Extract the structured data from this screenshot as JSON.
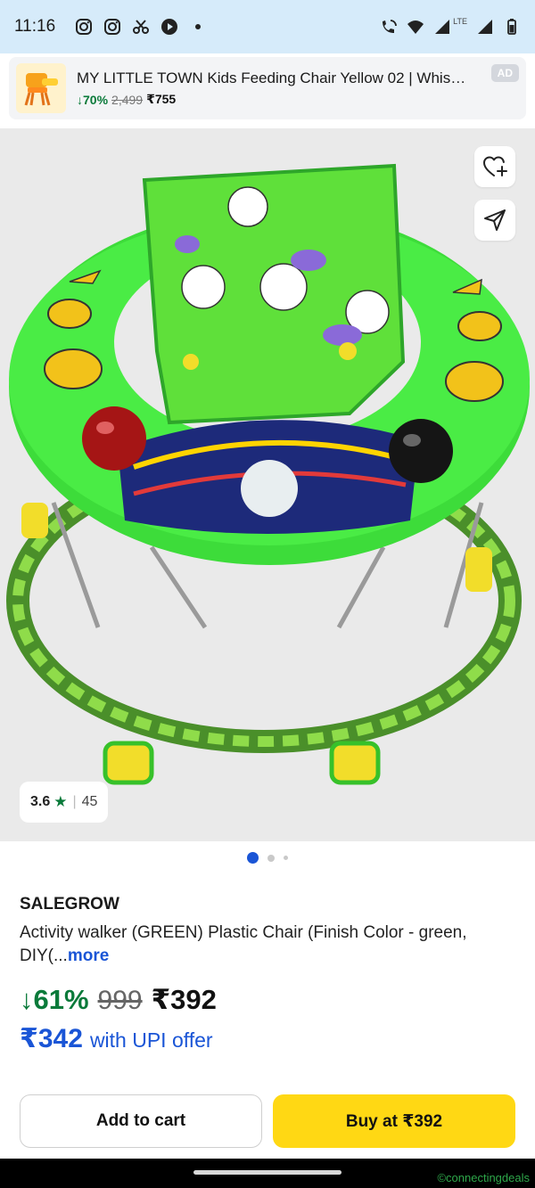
{
  "status_bar": {
    "time": "11:16",
    "left_icons": [
      "instagram-icon",
      "instagram-icon",
      "scissors-icon",
      "play-icon",
      "dot-icon"
    ],
    "network_label": "LTE",
    "right_icons": [
      "wifi-call-icon",
      "wifi-icon",
      "signal-icon",
      "signal-icon",
      "battery-icon"
    ]
  },
  "ad": {
    "title": "MY LITTLE TOWN Kids Feeding Chair Yellow 02 | Whistl...",
    "discount": "↓70%",
    "mrp": "2,499",
    "price": "₹755",
    "badge": "AD"
  },
  "product_image": {
    "rating_value": "3.6",
    "rating_star": "★",
    "rating_separator": "|",
    "rating_count": "45",
    "carousel_total": 3,
    "carousel_active": 1
  },
  "product": {
    "brand": "SALEGROW",
    "title": "Activity walker (GREEN) Plastic Chair (Finish Color - green, DIY(...",
    "more_label": "more",
    "discount": "↓61%",
    "mrp": "999",
    "price": "₹392",
    "upi_price": "₹342",
    "upi_text": "with UPI offer"
  },
  "actions": {
    "add_to_cart": "Add to cart",
    "buy": "Buy at ₹392"
  },
  "watermark": "©connectingdeals",
  "colors": {
    "status_bar_bg": "#d6ebfa",
    "accent_blue": "#1a55d6",
    "discount_green": "#0a7a3a",
    "buy_button": "#ffd814",
    "walker_green": "#3ddc3a"
  }
}
